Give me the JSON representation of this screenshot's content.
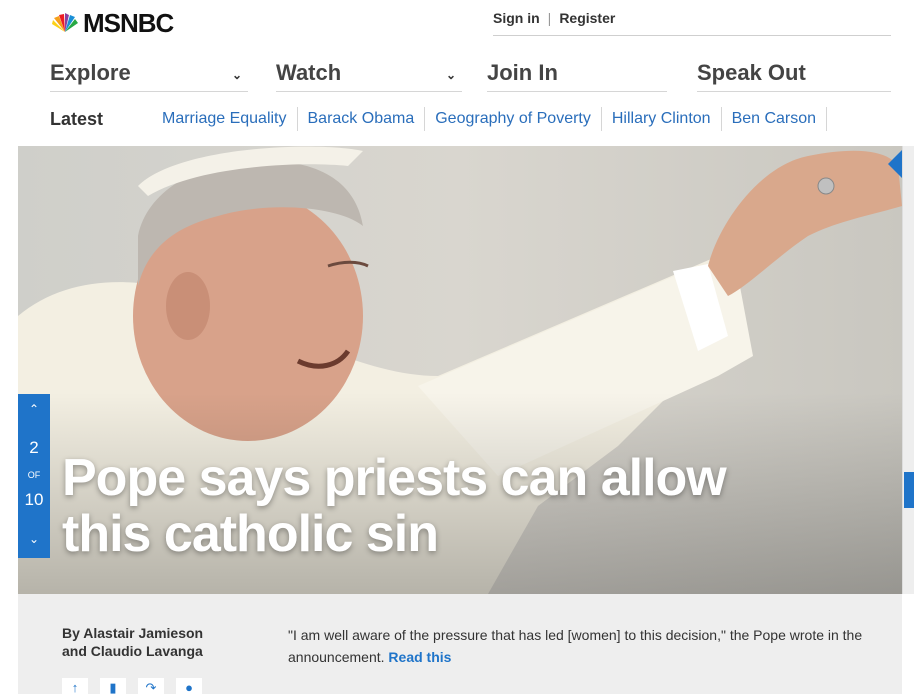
{
  "header": {
    "logo_text": "MSNBC",
    "sign_in": "Sign in",
    "divider": "|",
    "register": "Register"
  },
  "nav": {
    "explore": "Explore",
    "watch": "Watch",
    "join_in": "Join In",
    "speak_out": "Speak Out"
  },
  "latest": {
    "label": "Latest",
    "topics": [
      "Marriage Equality",
      "Barack Obama",
      "Geography of Poverty",
      "Hillary Clinton",
      "Ben Carson"
    ]
  },
  "slideshow": {
    "current": "2",
    "of_label": "OF",
    "total": "10"
  },
  "hero": {
    "headline_line1": "Pope says priests can allow",
    "headline_line2": "this catholic sin"
  },
  "article": {
    "byline_line1": "By Alastair Jamieson",
    "byline_line2": "and Claudio Lavanga",
    "quote": "\"I am well aware of the pressure that has led [women] to this decision,\" the Pope wrote in the announcement.",
    "read_more": "Read this"
  },
  "colors": {
    "accent_blue": "#1f74c9",
    "link_blue": "#2a6ebb"
  }
}
